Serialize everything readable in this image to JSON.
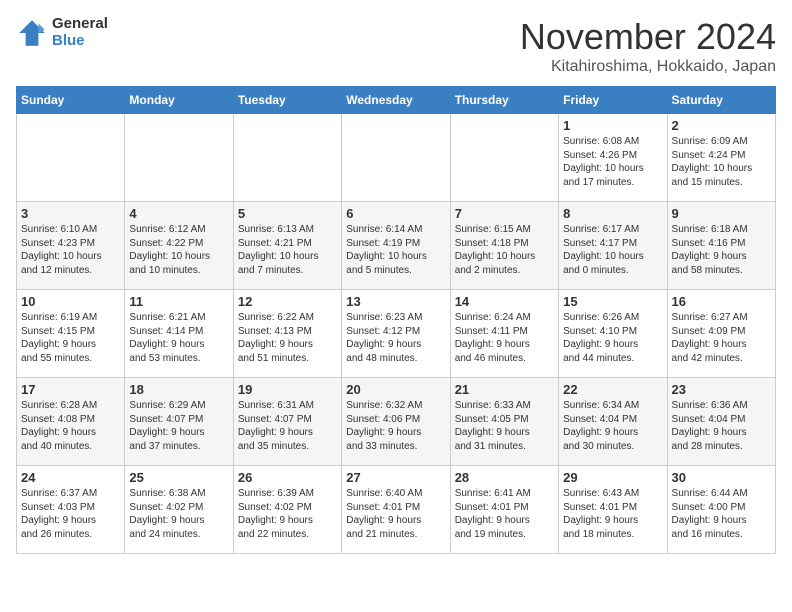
{
  "header": {
    "logo_general": "General",
    "logo_blue": "Blue",
    "month_year": "November 2024",
    "location": "Kitahiroshima, Hokkaido, Japan"
  },
  "days_of_week": [
    "Sunday",
    "Monday",
    "Tuesday",
    "Wednesday",
    "Thursday",
    "Friday",
    "Saturday"
  ],
  "weeks": [
    [
      {
        "day": "",
        "info": ""
      },
      {
        "day": "",
        "info": ""
      },
      {
        "day": "",
        "info": ""
      },
      {
        "day": "",
        "info": ""
      },
      {
        "day": "",
        "info": ""
      },
      {
        "day": "1",
        "info": "Sunrise: 6:08 AM\nSunset: 4:26 PM\nDaylight: 10 hours\nand 17 minutes."
      },
      {
        "day": "2",
        "info": "Sunrise: 6:09 AM\nSunset: 4:24 PM\nDaylight: 10 hours\nand 15 minutes."
      }
    ],
    [
      {
        "day": "3",
        "info": "Sunrise: 6:10 AM\nSunset: 4:23 PM\nDaylight: 10 hours\nand 12 minutes."
      },
      {
        "day": "4",
        "info": "Sunrise: 6:12 AM\nSunset: 4:22 PM\nDaylight: 10 hours\nand 10 minutes."
      },
      {
        "day": "5",
        "info": "Sunrise: 6:13 AM\nSunset: 4:21 PM\nDaylight: 10 hours\nand 7 minutes."
      },
      {
        "day": "6",
        "info": "Sunrise: 6:14 AM\nSunset: 4:19 PM\nDaylight: 10 hours\nand 5 minutes."
      },
      {
        "day": "7",
        "info": "Sunrise: 6:15 AM\nSunset: 4:18 PM\nDaylight: 10 hours\nand 2 minutes."
      },
      {
        "day": "8",
        "info": "Sunrise: 6:17 AM\nSunset: 4:17 PM\nDaylight: 10 hours\nand 0 minutes."
      },
      {
        "day": "9",
        "info": "Sunrise: 6:18 AM\nSunset: 4:16 PM\nDaylight: 9 hours\nand 58 minutes."
      }
    ],
    [
      {
        "day": "10",
        "info": "Sunrise: 6:19 AM\nSunset: 4:15 PM\nDaylight: 9 hours\nand 55 minutes."
      },
      {
        "day": "11",
        "info": "Sunrise: 6:21 AM\nSunset: 4:14 PM\nDaylight: 9 hours\nand 53 minutes."
      },
      {
        "day": "12",
        "info": "Sunrise: 6:22 AM\nSunset: 4:13 PM\nDaylight: 9 hours\nand 51 minutes."
      },
      {
        "day": "13",
        "info": "Sunrise: 6:23 AM\nSunset: 4:12 PM\nDaylight: 9 hours\nand 48 minutes."
      },
      {
        "day": "14",
        "info": "Sunrise: 6:24 AM\nSunset: 4:11 PM\nDaylight: 9 hours\nand 46 minutes."
      },
      {
        "day": "15",
        "info": "Sunrise: 6:26 AM\nSunset: 4:10 PM\nDaylight: 9 hours\nand 44 minutes."
      },
      {
        "day": "16",
        "info": "Sunrise: 6:27 AM\nSunset: 4:09 PM\nDaylight: 9 hours\nand 42 minutes."
      }
    ],
    [
      {
        "day": "17",
        "info": "Sunrise: 6:28 AM\nSunset: 4:08 PM\nDaylight: 9 hours\nand 40 minutes."
      },
      {
        "day": "18",
        "info": "Sunrise: 6:29 AM\nSunset: 4:07 PM\nDaylight: 9 hours\nand 37 minutes."
      },
      {
        "day": "19",
        "info": "Sunrise: 6:31 AM\nSunset: 4:07 PM\nDaylight: 9 hours\nand 35 minutes."
      },
      {
        "day": "20",
        "info": "Sunrise: 6:32 AM\nSunset: 4:06 PM\nDaylight: 9 hours\nand 33 minutes."
      },
      {
        "day": "21",
        "info": "Sunrise: 6:33 AM\nSunset: 4:05 PM\nDaylight: 9 hours\nand 31 minutes."
      },
      {
        "day": "22",
        "info": "Sunrise: 6:34 AM\nSunset: 4:04 PM\nDaylight: 9 hours\nand 30 minutes."
      },
      {
        "day": "23",
        "info": "Sunrise: 6:36 AM\nSunset: 4:04 PM\nDaylight: 9 hours\nand 28 minutes."
      }
    ],
    [
      {
        "day": "24",
        "info": "Sunrise: 6:37 AM\nSunset: 4:03 PM\nDaylight: 9 hours\nand 26 minutes."
      },
      {
        "day": "25",
        "info": "Sunrise: 6:38 AM\nSunset: 4:02 PM\nDaylight: 9 hours\nand 24 minutes."
      },
      {
        "day": "26",
        "info": "Sunrise: 6:39 AM\nSunset: 4:02 PM\nDaylight: 9 hours\nand 22 minutes."
      },
      {
        "day": "27",
        "info": "Sunrise: 6:40 AM\nSunset: 4:01 PM\nDaylight: 9 hours\nand 21 minutes."
      },
      {
        "day": "28",
        "info": "Sunrise: 6:41 AM\nSunset: 4:01 PM\nDaylight: 9 hours\nand 19 minutes."
      },
      {
        "day": "29",
        "info": "Sunrise: 6:43 AM\nSunset: 4:01 PM\nDaylight: 9 hours\nand 18 minutes."
      },
      {
        "day": "30",
        "info": "Sunrise: 6:44 AM\nSunset: 4:00 PM\nDaylight: 9 hours\nand 16 minutes."
      }
    ]
  ]
}
